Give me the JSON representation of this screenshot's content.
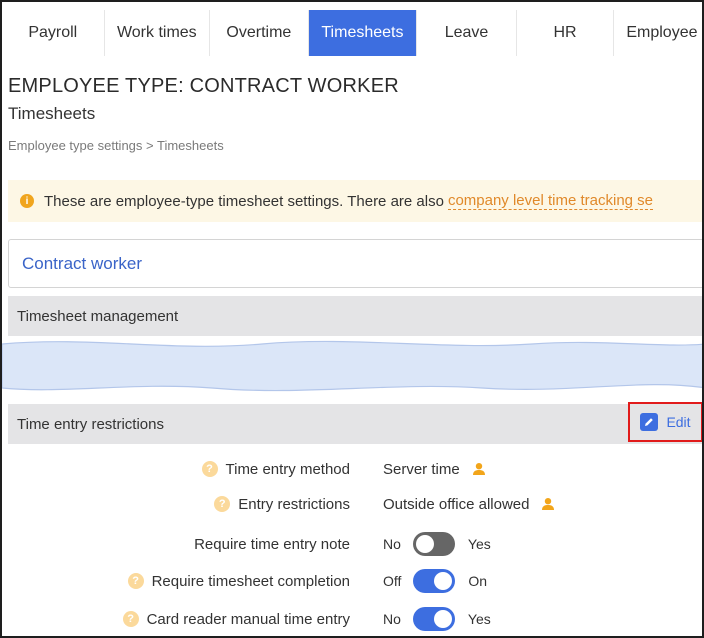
{
  "tabs": [
    {
      "label": "Payroll",
      "active": false
    },
    {
      "label": "Work times",
      "active": false
    },
    {
      "label": "Overtime",
      "active": false
    },
    {
      "label": "Timesheets",
      "active": true
    },
    {
      "label": "Leave",
      "active": false
    },
    {
      "label": "HR",
      "active": false
    },
    {
      "label": "Employee",
      "active": false
    }
  ],
  "page": {
    "title": "EMPLOYEE TYPE: CONTRACT WORKER",
    "subtitle": "Timesheets",
    "breadcrumb": "Employee type settings > Timesheets"
  },
  "notice": {
    "text": "These are employee-type timesheet settings. There are also",
    "link": "company level time tracking se"
  },
  "employee_type_select": {
    "value": "Contract worker"
  },
  "sections": {
    "timesheet_management": "Timesheet management",
    "time_entry_restrictions": "Time entry restrictions",
    "edit_label": "Edit"
  },
  "settings": [
    {
      "label": "Time entry method",
      "value": "Server time",
      "help": true,
      "person_icon": true
    },
    {
      "label": "Entry restrictions",
      "value": "Outside office allowed",
      "help": true,
      "person_icon": true
    },
    {
      "label": "Require time entry note",
      "help": false,
      "off_label": "No",
      "on_label": "Yes",
      "state": "off"
    },
    {
      "label": "Require timesheet completion",
      "help": true,
      "off_label": "Off",
      "on_label": "On",
      "state": "on"
    },
    {
      "label": "Card reader manual time entry",
      "help": true,
      "off_label": "No",
      "on_label": "Yes",
      "state": "on"
    }
  ],
  "colors": {
    "accent": "#3d6ee0",
    "highlight_border": "#e11b1b",
    "notice_bg": "#fdf7e5",
    "link": "#e0892a",
    "help_icon": "#fbd99b",
    "person_icon": "#f2a51a"
  }
}
